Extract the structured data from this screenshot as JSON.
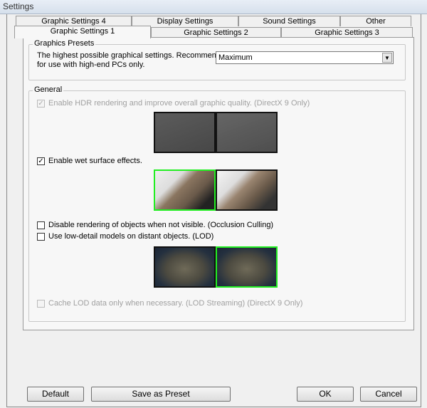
{
  "window": {
    "title": "Settings"
  },
  "tabs_row1": [
    "Graphic Settings 4",
    "Display Settings",
    "Sound Settings",
    "Other"
  ],
  "tabs_row2": [
    "Graphic Settings 1",
    "Graphic Settings 2",
    "Graphic Settings 3"
  ],
  "selected_tab": "Graphic Settings 1",
  "presets": {
    "label": "Graphics Presets",
    "description_line1": "The highest possible graphical settings. Recommended",
    "description_line2": "for use with high-end PCs only.",
    "selected": "Maximum"
  },
  "general": {
    "label": "General",
    "options": [
      {
        "label": "Enable HDR rendering and improve overall graphic quality. (DirectX 9 Only)",
        "checked": true,
        "enabled": false
      },
      {
        "label": "Enable wet surface effects.",
        "checked": true,
        "enabled": true
      },
      {
        "label": "Disable rendering of objects when not visible. (Occlusion Culling)",
        "checked": false,
        "enabled": true
      },
      {
        "label": "Use low-detail models on distant objects. (LOD)",
        "checked": false,
        "enabled": true
      },
      {
        "label": "Cache LOD data only when necessary. (LOD Streaming) (DirectX 9 Only)",
        "checked": false,
        "enabled": false
      }
    ]
  },
  "highlight_color": "#22ee22",
  "buttons": {
    "default": "Default",
    "save_preset": "Save as Preset",
    "ok": "OK",
    "cancel": "Cancel"
  }
}
